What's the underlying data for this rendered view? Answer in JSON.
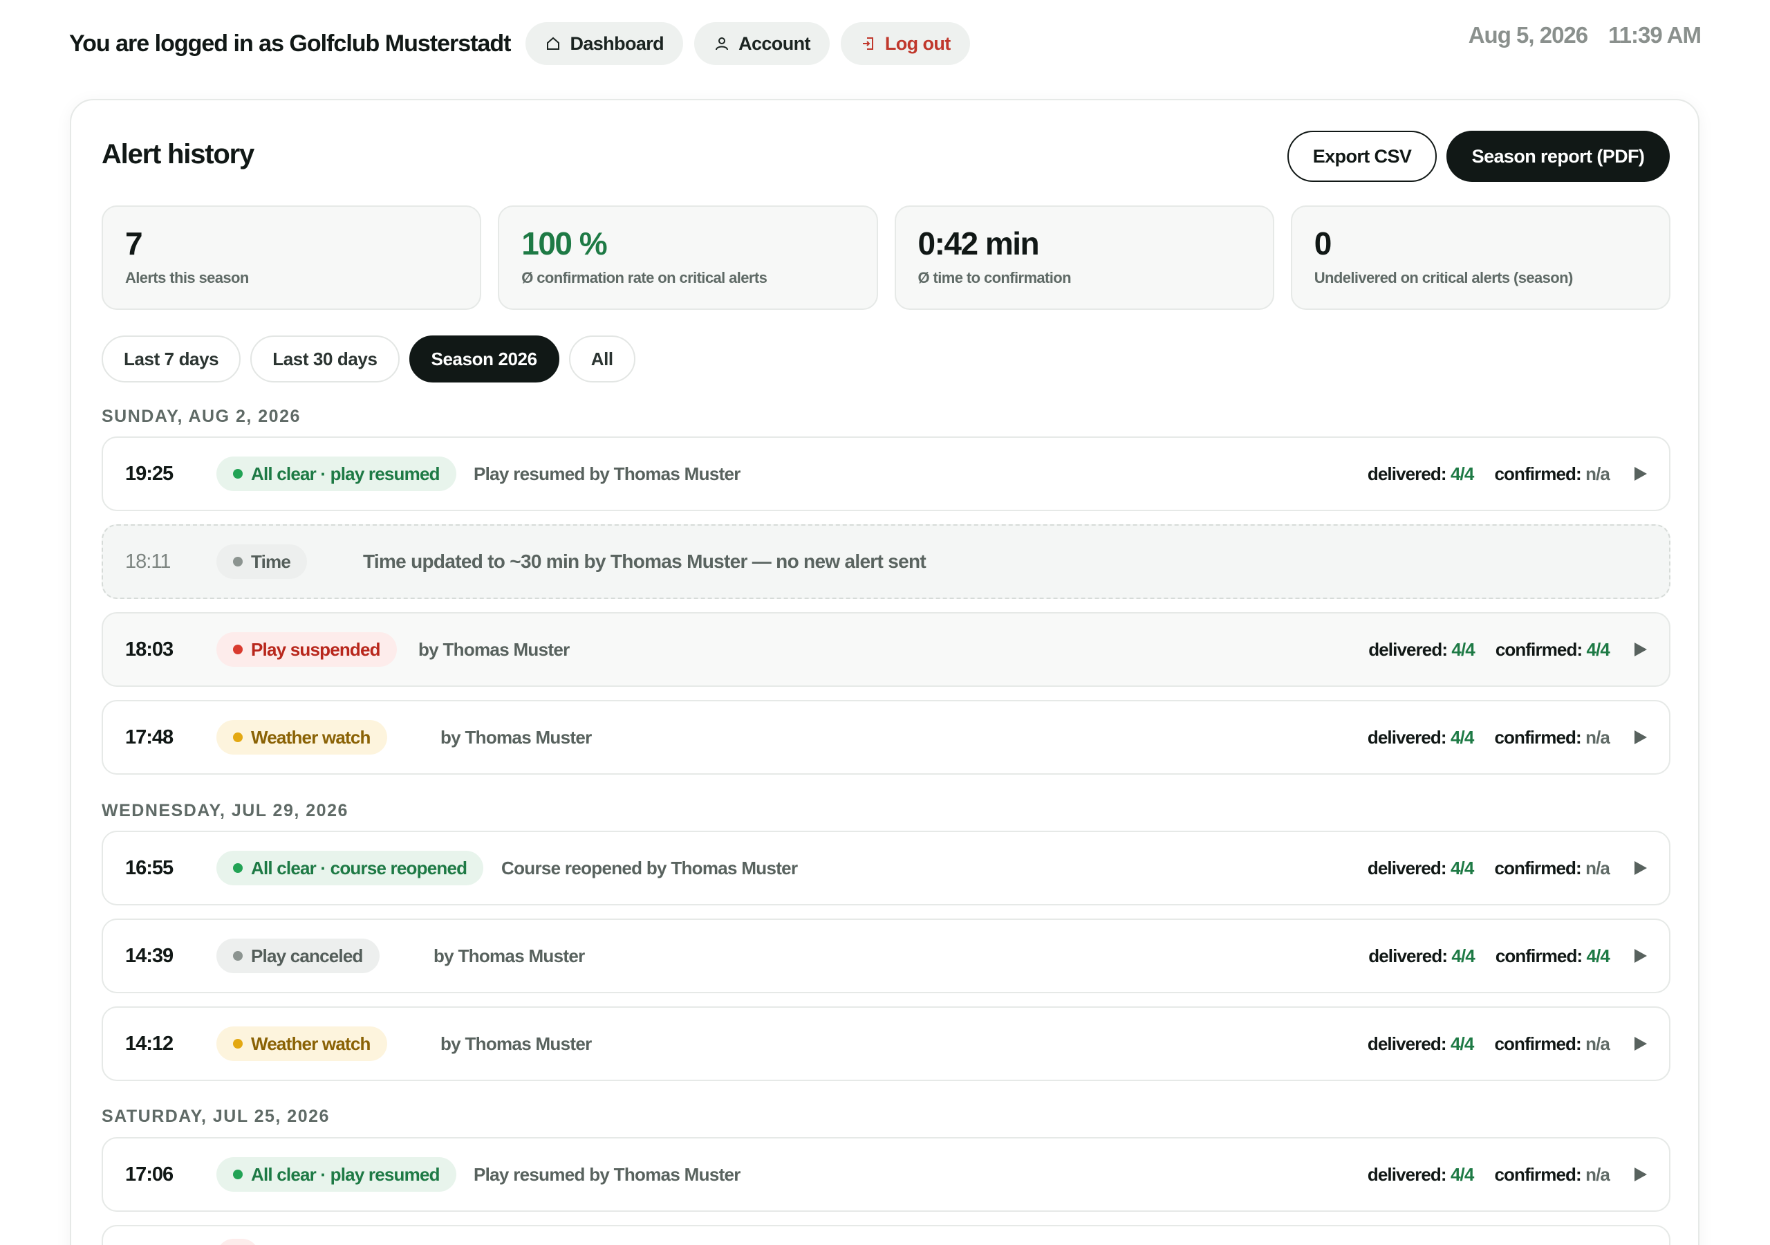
{
  "header": {
    "login_text": "You are logged in as Golfclub Musterstadt",
    "nav": {
      "dashboard": "Dashboard",
      "account": "Account",
      "logout": "Log out"
    },
    "date": "Aug 5, 2026",
    "time": "11:39 AM"
  },
  "card": {
    "title": "Alert history",
    "export_label": "Export CSV",
    "report_label": "Season report (PDF)"
  },
  "kpis": [
    {
      "value": "7",
      "label": "Alerts this season"
    },
    {
      "value": "100 %",
      "label": "Ø confirmation rate on critical alerts"
    },
    {
      "value": "0:42 min",
      "label": "Ø time to confirmation"
    },
    {
      "value": "0",
      "label": "Undelivered on critical alerts (season)"
    }
  ],
  "filters": [
    "Last 7 days",
    "Last 30 days",
    "Season 2026",
    "All"
  ],
  "active_filter": "Season 2026",
  "labels": {
    "delivered": "delivered:",
    "confirmed": "confirmed:"
  },
  "days": [
    {
      "heading": "SUNDAY, AUG 2, 2026",
      "entries": [
        {
          "time": "19:25",
          "badge": "All clear · play resumed",
          "tone": "green",
          "desc": "Play resumed by Thomas Muster",
          "delivered": "4/4",
          "confirmed": "n/a"
        },
        {
          "time": "18:11",
          "badge": "Time",
          "tone": "gray",
          "desc": "Time updated to ~30 min by Thomas Muster — no new alert sent"
        },
        {
          "time": "18:03",
          "badge": "Play suspended",
          "tone": "red",
          "desc": "by Thomas Muster",
          "delivered": "4/4",
          "confirmed": "4/4"
        },
        {
          "time": "17:48",
          "badge": "Weather watch",
          "tone": "amber",
          "desc": "by Thomas Muster",
          "delivered": "4/4",
          "confirmed": "n/a"
        }
      ]
    },
    {
      "heading": "WEDNESDAY, JUL 29, 2026",
      "entries": [
        {
          "time": "16:55",
          "badge": "All clear · course reopened",
          "tone": "green",
          "desc": "Course reopened by Thomas Muster",
          "delivered": "4/4",
          "confirmed": "n/a"
        },
        {
          "time": "14:39",
          "badge": "Play canceled",
          "tone": "gray",
          "desc": "by Thomas Muster",
          "delivered": "4/4",
          "confirmed": "4/4"
        },
        {
          "time": "14:12",
          "badge": "Weather watch",
          "tone": "amber",
          "desc": "by Thomas Muster",
          "delivered": "4/4",
          "confirmed": "n/a"
        }
      ]
    },
    {
      "heading": "SATURDAY, JUL 25, 2026",
      "entries": [
        {
          "time": "17:06",
          "badge": "All clear · play resumed",
          "tone": "green",
          "desc": "Play resumed by Thomas Muster",
          "delivered": "4/4",
          "confirmed": "n/a"
        }
      ]
    }
  ],
  "icons": {
    "dashboard": "home-icon",
    "account": "user-icon",
    "logout": "logout-icon",
    "expand": "play-triangle-icon"
  },
  "colors": {
    "accent_dark": "#111816",
    "success": "#1e7a45",
    "danger": "#b8271c",
    "warning": "#8a6205",
    "muted": "#5f6a66"
  }
}
